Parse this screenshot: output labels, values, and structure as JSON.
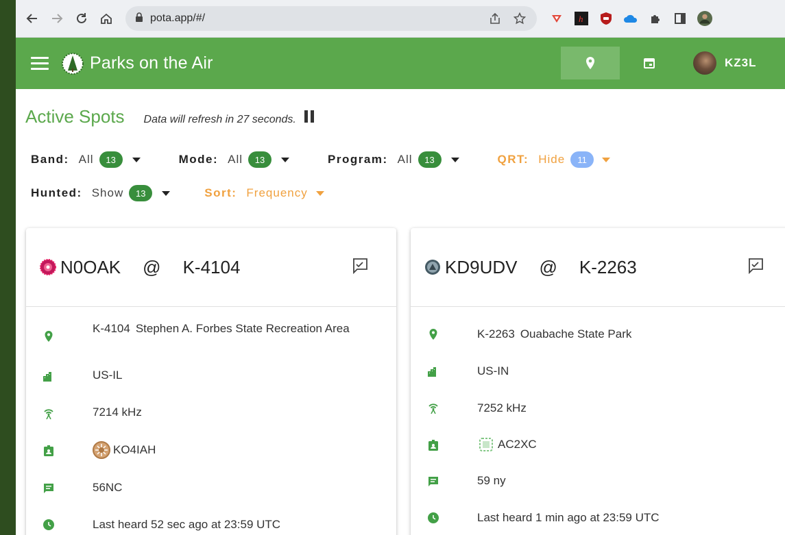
{
  "browser": {
    "url": "pota.app/#/"
  },
  "app": {
    "title": "Parks on the Air",
    "user": "KZ3L"
  },
  "spots": {
    "title": "Active Spots",
    "refresh_text": "Data will refresh in 27 seconds."
  },
  "filters": {
    "band": {
      "label": "Band:",
      "value": "All",
      "count": "13"
    },
    "mode": {
      "label": "Mode:",
      "value": "All",
      "count": "13"
    },
    "program": {
      "label": "Program:",
      "value": "All",
      "count": "13"
    },
    "qrt": {
      "label": "QRT:",
      "value": "Hide",
      "count": "11"
    },
    "hunted": {
      "label": "Hunted:",
      "value": "Show",
      "count": "13"
    },
    "sort": {
      "label": "Sort:",
      "value": "Frequency"
    }
  },
  "cards": [
    {
      "callsign": "N0OAK",
      "at": "@",
      "park": "K-4104",
      "park_ref": "K-4104",
      "park_name": "Stephen A. Forbes State Recreation Area",
      "location": "US-IL",
      "frequency": "7214 kHz",
      "spotter": "KO4IAH",
      "comment": "56NC",
      "last_heard": "Last heard 52 sec ago at 23:59 UTC"
    },
    {
      "callsign": "KD9UDV",
      "at": "@",
      "park": "K-2263",
      "park_ref": "K-2263",
      "park_name": "Ouabache State Park",
      "location": "US-IN",
      "frequency": "7252 kHz",
      "spotter": "AC2XC",
      "comment": "59 ny",
      "last_heard": "Last heard 1 min ago at 23:59 UTC"
    }
  ],
  "colors": {
    "brand_green": "#5ba84c",
    "accent_orange": "#f0a13f",
    "badge_green": "#388e3c",
    "badge_blue": "#8ab4f8"
  }
}
